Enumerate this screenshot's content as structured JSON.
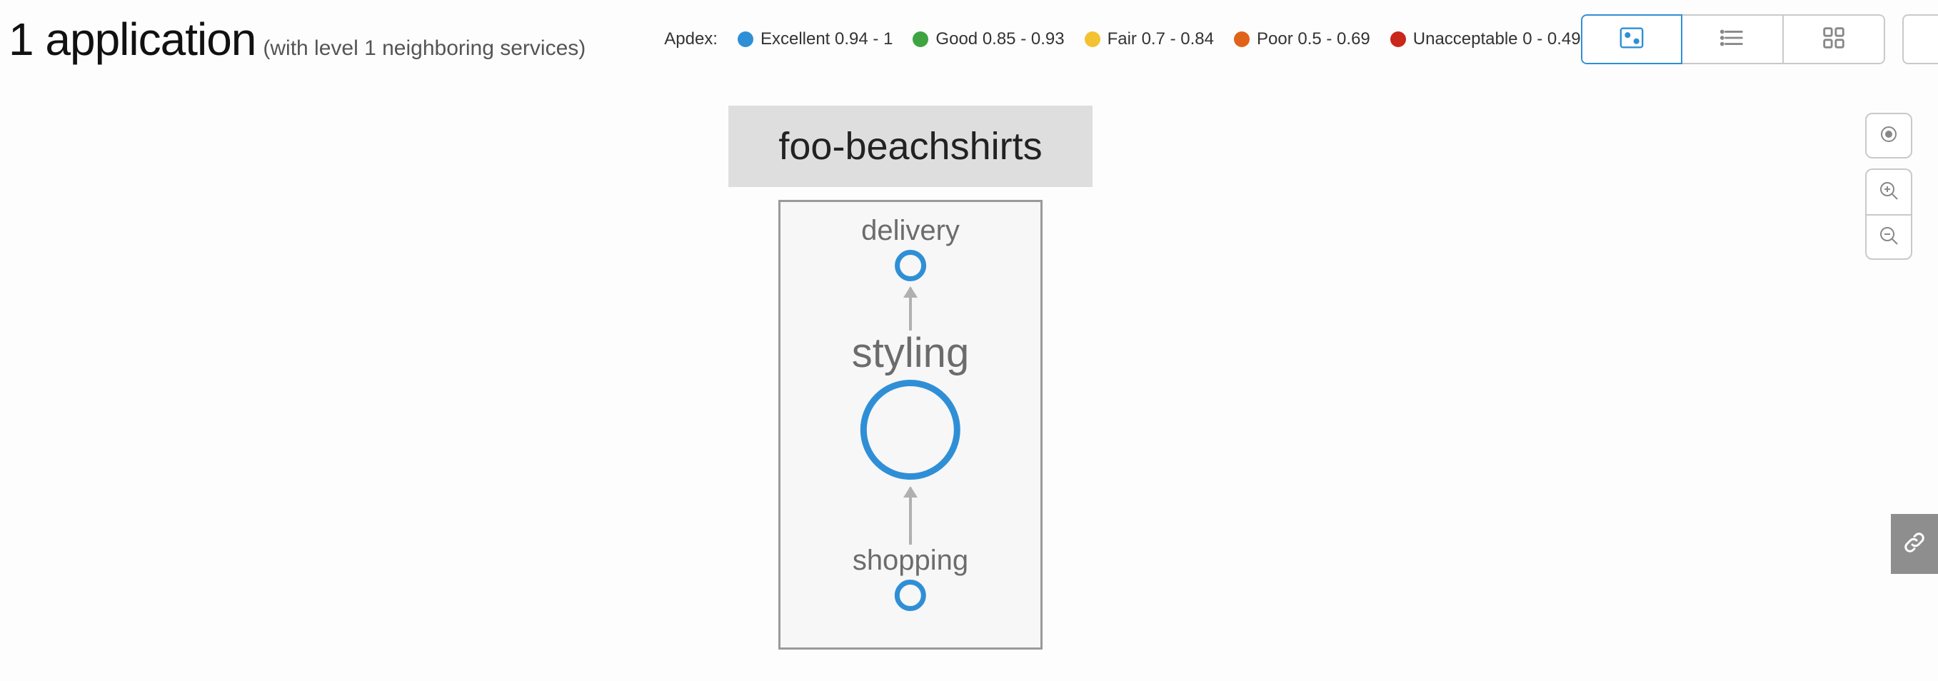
{
  "header": {
    "title": "1 application",
    "subtitle": "(with level 1 neighboring services)"
  },
  "legend": {
    "label": "Apdex:",
    "items": [
      {
        "name": "Excellent",
        "range": "0.94 - 1",
        "color": "#2f8fd6"
      },
      {
        "name": "Good",
        "range": "0.85 - 0.93",
        "color": "#3da441"
      },
      {
        "name": "Fair",
        "range": "0.7 - 0.84",
        "color": "#f2c233"
      },
      {
        "name": "Poor",
        "range": "0.5 - 0.69",
        "color": "#e0631a"
      },
      {
        "name": "Unacceptable",
        "range": "0 - 0.49",
        "color": "#c8271a"
      }
    ]
  },
  "app": {
    "name": "foo-beachshirts",
    "nodes": {
      "top": {
        "label": "delivery"
      },
      "middle": {
        "label": "styling"
      },
      "bottom": {
        "label": "shopping"
      }
    }
  }
}
